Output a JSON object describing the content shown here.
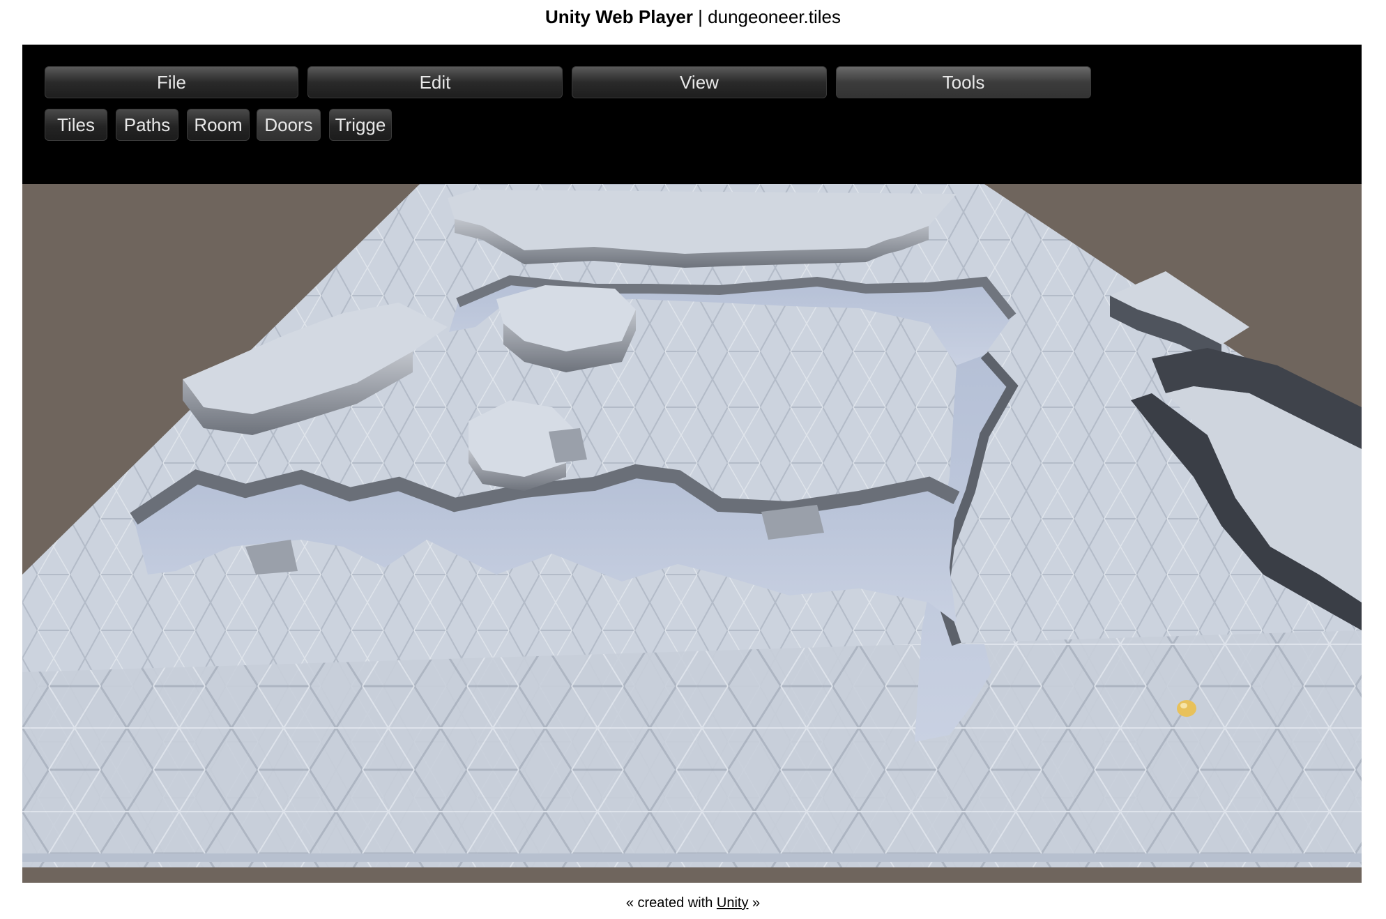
{
  "page": {
    "title_bold": "Unity Web Player",
    "title_separator": " | ",
    "title_rest": "dungeoneer.tiles"
  },
  "menu": {
    "items": [
      {
        "label": "File"
      },
      {
        "label": "Edit"
      },
      {
        "label": "View"
      },
      {
        "label": "Tools",
        "active": true
      }
    ]
  },
  "tools": {
    "items": [
      {
        "label": "Tiles"
      },
      {
        "label": "Paths"
      },
      {
        "label": "Room"
      },
      {
        "label": "Doors",
        "active": true
      },
      {
        "label": "Trigge"
      }
    ]
  },
  "footer": {
    "prefix": "« created with ",
    "link": "Unity",
    "suffix": " »"
  },
  "colors": {
    "background": "#6f655d",
    "toolbar": "#000000",
    "floor": "#c9d0db",
    "wall": "#8d929c"
  }
}
